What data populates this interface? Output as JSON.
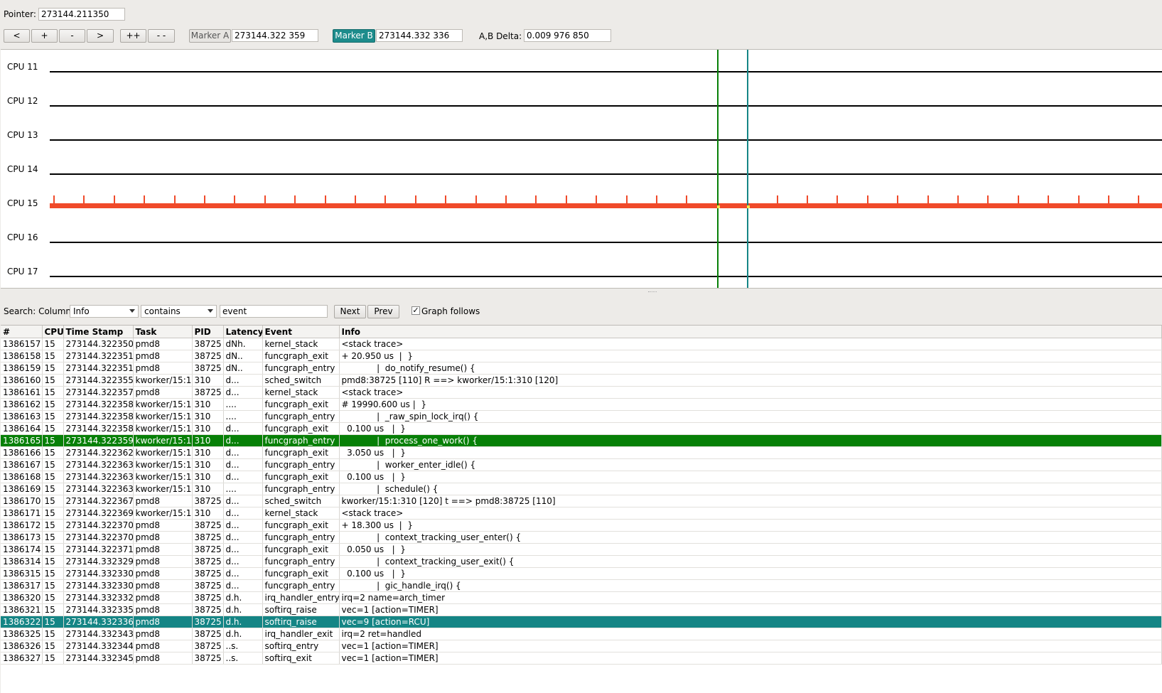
{
  "pointer": {
    "label": "Pointer:",
    "value": "273144.211350"
  },
  "toolbar": {
    "zoom_buttons": [
      "<",
      "+",
      "-",
      ">",
      "++",
      "- -"
    ],
    "marker_a": {
      "label": "Marker A",
      "value": "273144.322 359"
    },
    "marker_b": {
      "label": "Marker B",
      "value": "273144.332 336"
    },
    "delta": {
      "label": "A,B Delta:",
      "value": "0.009 976 850"
    }
  },
  "graph": {
    "cpus": [
      "CPU 11",
      "CPU 12",
      "CPU 13",
      "CPU 14",
      "CPU 15",
      "CPU 16",
      "CPU 17"
    ],
    "colors": {
      "cpu15_activity": "#f04a2a",
      "marker_a": "#078007",
      "marker_b": "#158585"
    }
  },
  "search": {
    "label": "Search: Column",
    "column": "Info",
    "mode": "contains",
    "text": "event",
    "next_label": "Next",
    "prev_label": "Prev",
    "graph_follows_label": "Graph follows",
    "graph_follows_checked": true
  },
  "table": {
    "headers": [
      "#",
      "CPU",
      "Time Stamp",
      "Task",
      "PID",
      "Latency",
      "Event",
      "Info"
    ],
    "rows": [
      [
        "1386157",
        "15",
        "273144.322350",
        "pmd8",
        "38725",
        "dNh.",
        "kernel_stack",
        "<stack trace>"
      ],
      [
        "1386158",
        "15",
        "273144.322351",
        "pmd8",
        "38725",
        "dN..",
        "funcgraph_exit",
        "+ 20.950 us  |  }"
      ],
      [
        "1386159",
        "15",
        "273144.322351",
        "pmd8",
        "38725",
        "dN..",
        "funcgraph_entry",
        "             |  do_notify_resume() {"
      ],
      [
        "1386160",
        "15",
        "273144.322355",
        "kworker/15:1",
        "310",
        "d...",
        "sched_switch",
        "pmd8:38725 [110] R ==> kworker/15:1:310 [120]"
      ],
      [
        "1386161",
        "15",
        "273144.322357",
        "pmd8",
        "38725",
        "d...",
        "kernel_stack",
        "<stack trace>"
      ],
      [
        "1386162",
        "15",
        "273144.322358",
        "kworker/15:1",
        "310",
        "....",
        "funcgraph_exit",
        "# 19990.600 us |  }"
      ],
      [
        "1386163",
        "15",
        "273144.322358",
        "kworker/15:1",
        "310",
        "....",
        "funcgraph_entry",
        "             |  _raw_spin_lock_irq() {"
      ],
      [
        "1386164",
        "15",
        "273144.322358",
        "kworker/15:1",
        "310",
        "d...",
        "funcgraph_exit",
        "  0.100 us   |  }"
      ],
      [
        "1386165",
        "15",
        "273144.322359",
        "kworker/15:1",
        "310",
        "d...",
        "funcgraph_entry",
        "             |  process_one_work() {"
      ],
      [
        "1386166",
        "15",
        "273144.322362",
        "kworker/15:1",
        "310",
        "d...",
        "funcgraph_exit",
        "  3.050 us   |  }"
      ],
      [
        "1386167",
        "15",
        "273144.322363",
        "kworker/15:1",
        "310",
        "d...",
        "funcgraph_entry",
        "             |  worker_enter_idle() {"
      ],
      [
        "1386168",
        "15",
        "273144.322363",
        "kworker/15:1",
        "310",
        "d...",
        "funcgraph_exit",
        "  0.100 us   |  }"
      ],
      [
        "1386169",
        "15",
        "273144.322363",
        "kworker/15:1",
        "310",
        "....",
        "funcgraph_entry",
        "             |  schedule() {"
      ],
      [
        "1386170",
        "15",
        "273144.322367",
        "pmd8",
        "38725",
        "d...",
        "sched_switch",
        "kworker/15:1:310 [120] t ==> pmd8:38725 [110]"
      ],
      [
        "1386171",
        "15",
        "273144.322369",
        "kworker/15:1",
        "310",
        "d...",
        "kernel_stack",
        "<stack trace>"
      ],
      [
        "1386172",
        "15",
        "273144.322370",
        "pmd8",
        "38725",
        "d...",
        "funcgraph_exit",
        "+ 18.300 us  |  }"
      ],
      [
        "1386173",
        "15",
        "273144.322370",
        "pmd8",
        "38725",
        "d...",
        "funcgraph_entry",
        "             |  context_tracking_user_enter() {"
      ],
      [
        "1386174",
        "15",
        "273144.322371",
        "pmd8",
        "38725",
        "d...",
        "funcgraph_exit",
        "  0.050 us   |  }"
      ],
      [
        "1386314",
        "15",
        "273144.332329",
        "pmd8",
        "38725",
        "d...",
        "funcgraph_entry",
        "             |  context_tracking_user_exit() {"
      ],
      [
        "1386315",
        "15",
        "273144.332330",
        "pmd8",
        "38725",
        "d...",
        "funcgraph_exit",
        "  0.100 us   |  }"
      ],
      [
        "1386317",
        "15",
        "273144.332330",
        "pmd8",
        "38725",
        "d...",
        "funcgraph_entry",
        "             |  gic_handle_irq() {"
      ],
      [
        "1386320",
        "15",
        "273144.332332",
        "pmd8",
        "38725",
        "d.h.",
        "irq_handler_entry",
        "irq=2 name=arch_timer"
      ],
      [
        "1386321",
        "15",
        "273144.332335",
        "pmd8",
        "38725",
        "d.h.",
        "softirq_raise",
        "vec=1 [action=TIMER]"
      ],
      [
        "1386322",
        "15",
        "273144.332336",
        "pmd8",
        "38725",
        "d.h.",
        "softirq_raise",
        "vec=9 [action=RCU]"
      ],
      [
        "1386325",
        "15",
        "273144.332343",
        "pmd8",
        "38725",
        "d.h.",
        "irq_handler_exit",
        "irq=2 ret=handled"
      ],
      [
        "1386326",
        "15",
        "273144.332344",
        "pmd8",
        "38725",
        "..s.",
        "softirq_entry",
        "vec=1 [action=TIMER]"
      ],
      [
        "1386327",
        "15",
        "273144.332345",
        "pmd8",
        "38725",
        "..s.",
        "softirq_exit",
        "vec=1 [action=TIMER]"
      ]
    ],
    "selected_a_row": "1386165",
    "selected_b_row": "1386322"
  }
}
